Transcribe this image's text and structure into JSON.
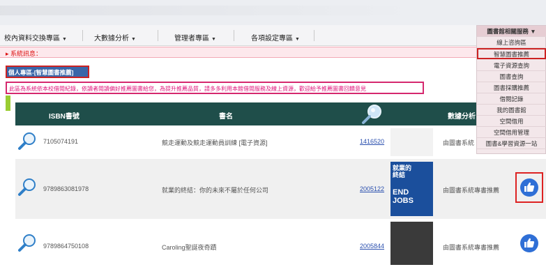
{
  "nav": {
    "items": [
      {
        "label": "校內資料交換專區",
        "caret": "▼"
      },
      {
        "label": "大數據分析",
        "caret": "▼"
      },
      {
        "label": "管理者專區",
        "caret": "▼"
      },
      {
        "label": "各項設定專區",
        "caret": "▼"
      }
    ]
  },
  "system_message": "系統訊息：",
  "breadcrumb": "個人專區-[智慧圖書推薦]",
  "notice": "此區為系統依本校借閱紀錄，依讀者閱讀偏好推薦圖書給您，為提升推薦品質，請多多利用本館借閱服務及線上資源，歡迎給予推薦圖書回饋意見",
  "table": {
    "headers": {
      "isbn": "ISBN書號",
      "title": "書名",
      "source": "數據分析"
    },
    "rows": [
      {
        "isbn": "7105074191",
        "title": "競走運動及競走運動員訓練 [電子資源]",
        "call_no": "1416520",
        "source": "由圖書系統"
      },
      {
        "isbn": "9789863081978",
        "title": "就業的終結：你的未來不屬於任何公司",
        "call_no": "2005122",
        "source": "由圖書系統專書推薦"
      },
      {
        "isbn": "9789864750108",
        "title": "Caroling聖誕夜奇蹟",
        "call_no": "2005844",
        "source": "由圖書系統專書推薦"
      }
    ]
  },
  "book_cover": {
    "title_line1": "就業的",
    "title_line2": "終結",
    "big_line1": "END",
    "big_line2": "JOBS"
  },
  "dropdown": {
    "header": "圖書館相關服務 ▼",
    "items": [
      "線上咨詢區",
      "智慧圖書推薦",
      "電子資源查詢",
      "圖書查詢",
      "圖書採購推薦",
      "借閱記錄",
      "我的圖書館",
      "空間借用",
      "空間借用管理",
      "圖書&學習資源一站"
    ]
  },
  "colors": {
    "table_header": "#1f4e4a",
    "highlight_border": "#cc2222",
    "notice_text": "#e0147a",
    "like_button": "#2f6fd6",
    "dropdown_bg": "#f3e7ea"
  }
}
